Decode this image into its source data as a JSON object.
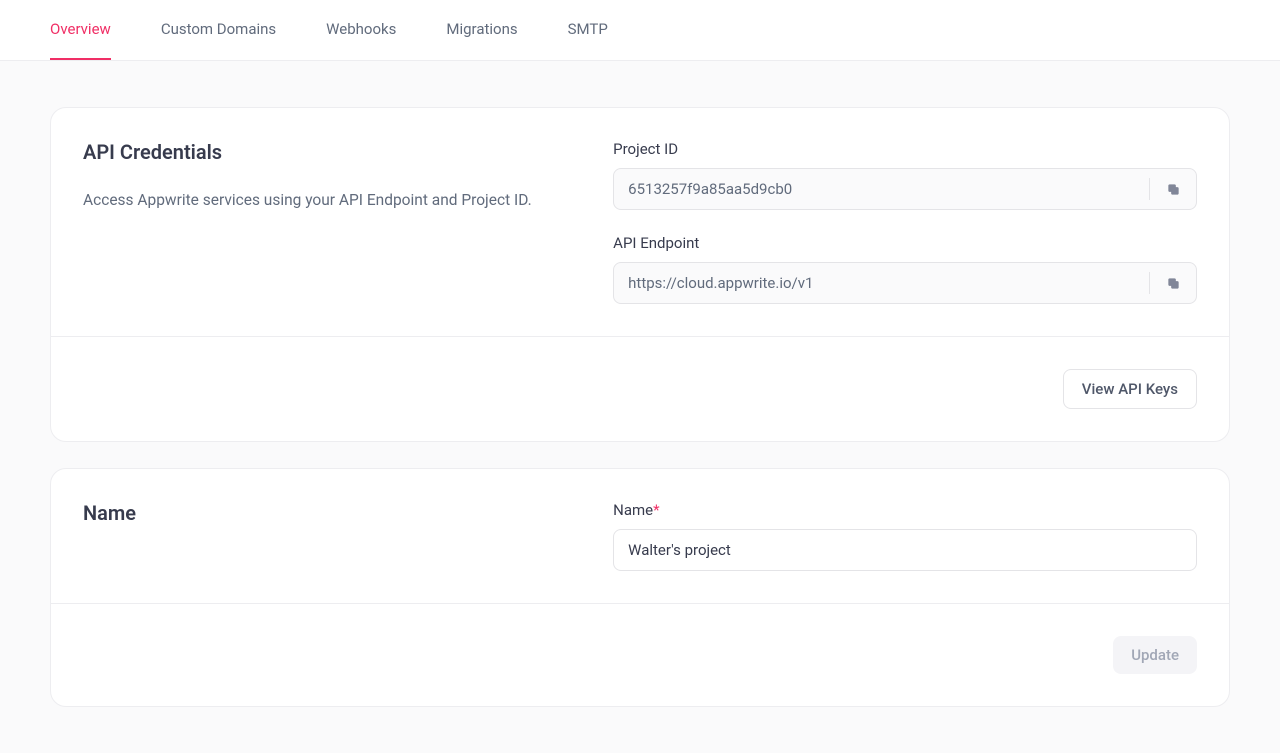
{
  "tabs": [
    {
      "label": "Overview",
      "active": true
    },
    {
      "label": "Custom Domains",
      "active": false
    },
    {
      "label": "Webhooks",
      "active": false
    },
    {
      "label": "Migrations",
      "active": false
    },
    {
      "label": "SMTP",
      "active": false
    }
  ],
  "api_credentials": {
    "title": "API Credentials",
    "description": "Access Appwrite services using your API Endpoint and Project ID.",
    "project_id_label": "Project ID",
    "project_id_value": "6513257f9a85aa5d9cb0",
    "api_endpoint_label": "API Endpoint",
    "api_endpoint_value": "https://cloud.appwrite.io/v1",
    "view_api_keys_label": "View API Keys"
  },
  "name_card": {
    "title": "Name",
    "field_label": "Name",
    "required_mark": "*",
    "value": "Walter's project",
    "update_label": "Update"
  }
}
